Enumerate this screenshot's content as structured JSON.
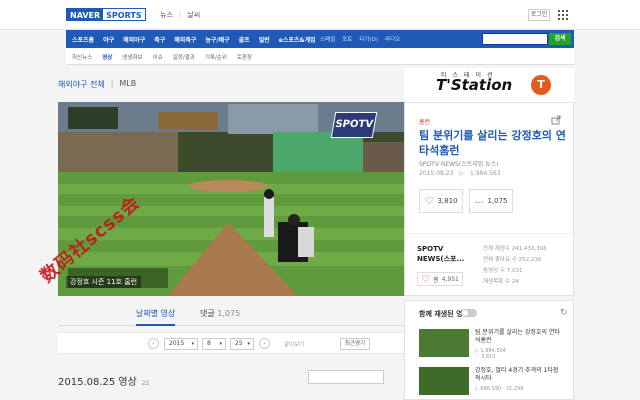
{
  "header": {
    "logo_naver": "NAVER",
    "logo_sports": "SPORTS",
    "links": [
      "뉴스",
      "날씨"
    ],
    "login_label": "로그인"
  },
  "nav": {
    "main_items": [
      "스포츠홈",
      "야구",
      "해외야구",
      "축구",
      "해외축구",
      "농구/배구",
      "골프",
      "일반",
      "e스포츠&게임"
    ],
    "extra_items": [
      "스페셜",
      "포토",
      "타기(D)",
      "라디오"
    ],
    "search_button": "검색"
  },
  "subnav": {
    "items": [
      "최신뉴스",
      "영상",
      "생생화보",
      "이슈",
      "일정/결과",
      "기록/순위",
      "토론장"
    ],
    "active_index": 1
  },
  "breadcrumb": {
    "section": "해외야구 전체",
    "sub": "MLB"
  },
  "banner": {
    "ko": "티스테이션",
    "en": "T'Station",
    "badge": "T"
  },
  "video": {
    "channel_logo": "SPOTV",
    "caption": "강정호 시즌 11호 홈런"
  },
  "side": {
    "category": "홈런",
    "title": "팀 분위기를 살리는 강정호의 연타석홈런",
    "source": "SPOTV NEWS(스트리밍 뉴스)",
    "date": "2015.08.23",
    "views": "1,984,563",
    "likes": "3,810",
    "comments": "1,075",
    "channel_name": "SPOTV NEWS(스포...",
    "channel_likes": "4,951",
    "channel_stats": [
      "전체 재생수 241,433,306",
      "전체 좋아요 수 252,236",
      "동영상 수 7,031",
      "재생목록 수 24"
    ]
  },
  "tabs": [
    {
      "label": "",
      "count": ""
    },
    {
      "label": "날짜별 영상",
      "count": ""
    },
    {
      "label": "댓글",
      "count": "1,075"
    }
  ],
  "datebar": {
    "year": "2015",
    "month": "8",
    "day": "25",
    "go_label": "같이보기",
    "recent_label": "최근경기"
  },
  "date_heading": {
    "text": "2015.08.25 영상",
    "count": "22"
  },
  "autoplay": {
    "title": "함께 재생된 영상",
    "items": [
      {
        "title": "팀 분위기를 살리는 강정호의 연타석홈런",
        "meta1": "▷ 1,984,504",
        "meta2": "♡ 3,810"
      },
      {
        "title": "강정호, 멀티 4경기 추격의 1타점 적시타",
        "meta1": "▷ 688,590 · 21,298",
        "meta2": ""
      }
    ]
  },
  "watermark": "数码社scss会",
  "colors": {
    "brand_blue": "#1e5ab6",
    "search_green": "#1fa52e",
    "accent_red": "#e0391d",
    "tstation_orange": "#e65b1c"
  }
}
